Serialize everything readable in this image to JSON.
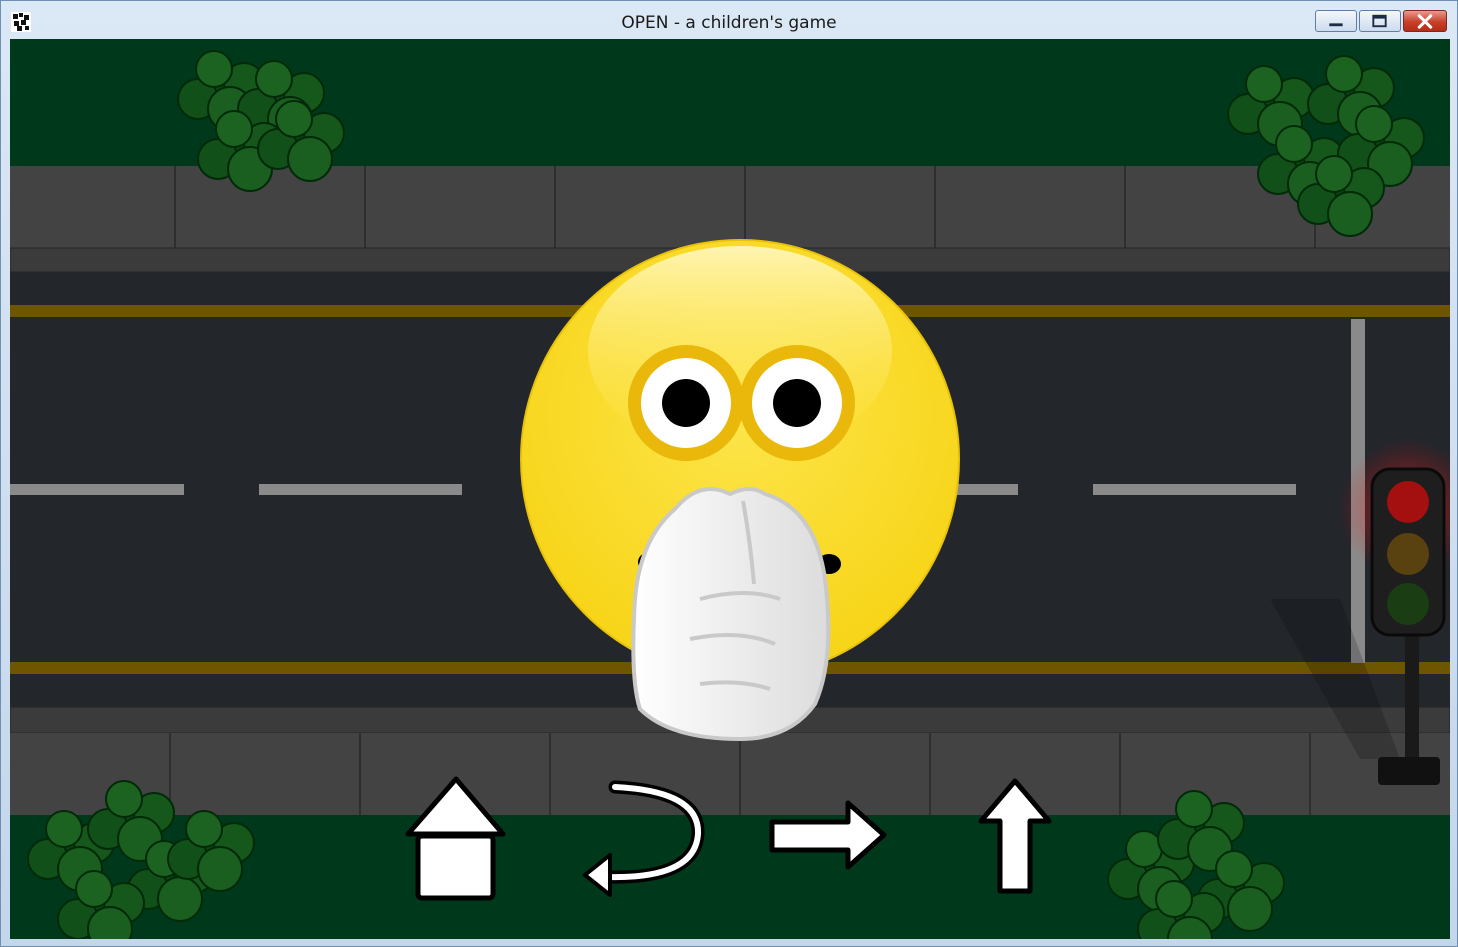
{
  "window": {
    "title": "OPEN - a children's game",
    "controls": [
      "minimize",
      "maximize",
      "close"
    ]
  },
  "scene": {
    "background": "road",
    "traffic_light_state": "red",
    "character": "yellow smiley covering mouth with hands",
    "colors": {
      "grass": "#00381b",
      "sidewalk": "#414141",
      "road": "#23262b",
      "yellow_line": "#6e5500",
      "smiley": "#fcd920",
      "traffic_red": "#8a0a0a"
    }
  },
  "nav": {
    "home_icon": "home-icon",
    "back_icon": "u-turn-arrow-icon",
    "right_icon": "right-arrow-icon",
    "up_icon": "up-arrow-icon"
  }
}
